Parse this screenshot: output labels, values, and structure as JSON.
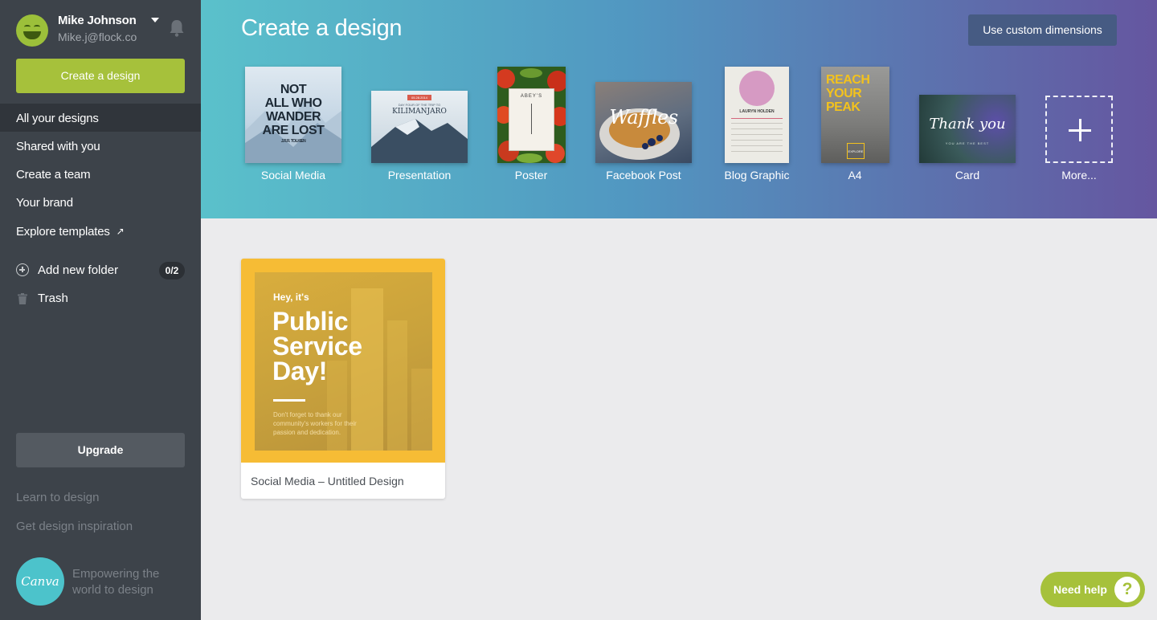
{
  "user": {
    "name": "Mike Johnson",
    "email": "Mike.j@flock.co"
  },
  "sidebar": {
    "create_label": "Create a design",
    "nav": [
      {
        "label": "All your designs"
      },
      {
        "label": "Shared with you"
      },
      {
        "label": "Create a team"
      },
      {
        "label": "Your brand"
      },
      {
        "label": "Explore templates",
        "icon": "external-link-icon"
      }
    ],
    "add_folder_label": "Add new folder",
    "folder_count": "0/2",
    "trash_label": "Trash",
    "upgrade_label": "Upgrade",
    "learn_label": "Learn to design",
    "inspiration_label": "Get design inspiration",
    "logo_text": "Canva",
    "tagline": "Empowering the world to design"
  },
  "header": {
    "title": "Create a design",
    "custom_dimensions_label": "Use custom dimensions",
    "templates": [
      {
        "label": "Social Media",
        "thumb_text": [
          "NOT",
          "ALL WHO",
          "WANDER",
          "ARE LOST",
          "J.R.R. TOLKIEN"
        ]
      },
      {
        "label": "Presentation",
        "thumb_text": [
          "05.28.2014",
          "DAY FOUR OF THE TRIP TO",
          "KILIMANJARO"
        ]
      },
      {
        "label": "Poster",
        "thumb_text": [
          "ABEY'S"
        ]
      },
      {
        "label": "Facebook Post",
        "thumb_text": [
          "Waffles"
        ]
      },
      {
        "label": "Blog Graphic",
        "thumb_text": [
          "LAURYN HOLDEN"
        ]
      },
      {
        "label": "A4",
        "thumb_text": [
          "REACH",
          "YOUR",
          "PEAK",
          "EXPLORE"
        ]
      },
      {
        "label": "Card",
        "thumb_text": [
          "Thank you",
          "YOU ARE THE BEST"
        ]
      },
      {
        "label": "More..."
      }
    ]
  },
  "designs": [
    {
      "caption": "Social Media – Untitled Design",
      "thumb_text": {
        "kicker": "Hey, it's",
        "line1": "Public",
        "line2": "Service",
        "line3": "Day!",
        "body": "Don't forget to thank our community's workers for their passion and dedication."
      }
    }
  ],
  "help": {
    "label": "Need help",
    "icon": "?"
  },
  "colors": {
    "accent_green": "#a6c13b",
    "sidebar": "#3d434a",
    "header_start": "#5ac1cb",
    "header_end": "#6556a0",
    "card_yellow": "#f6bc35"
  }
}
